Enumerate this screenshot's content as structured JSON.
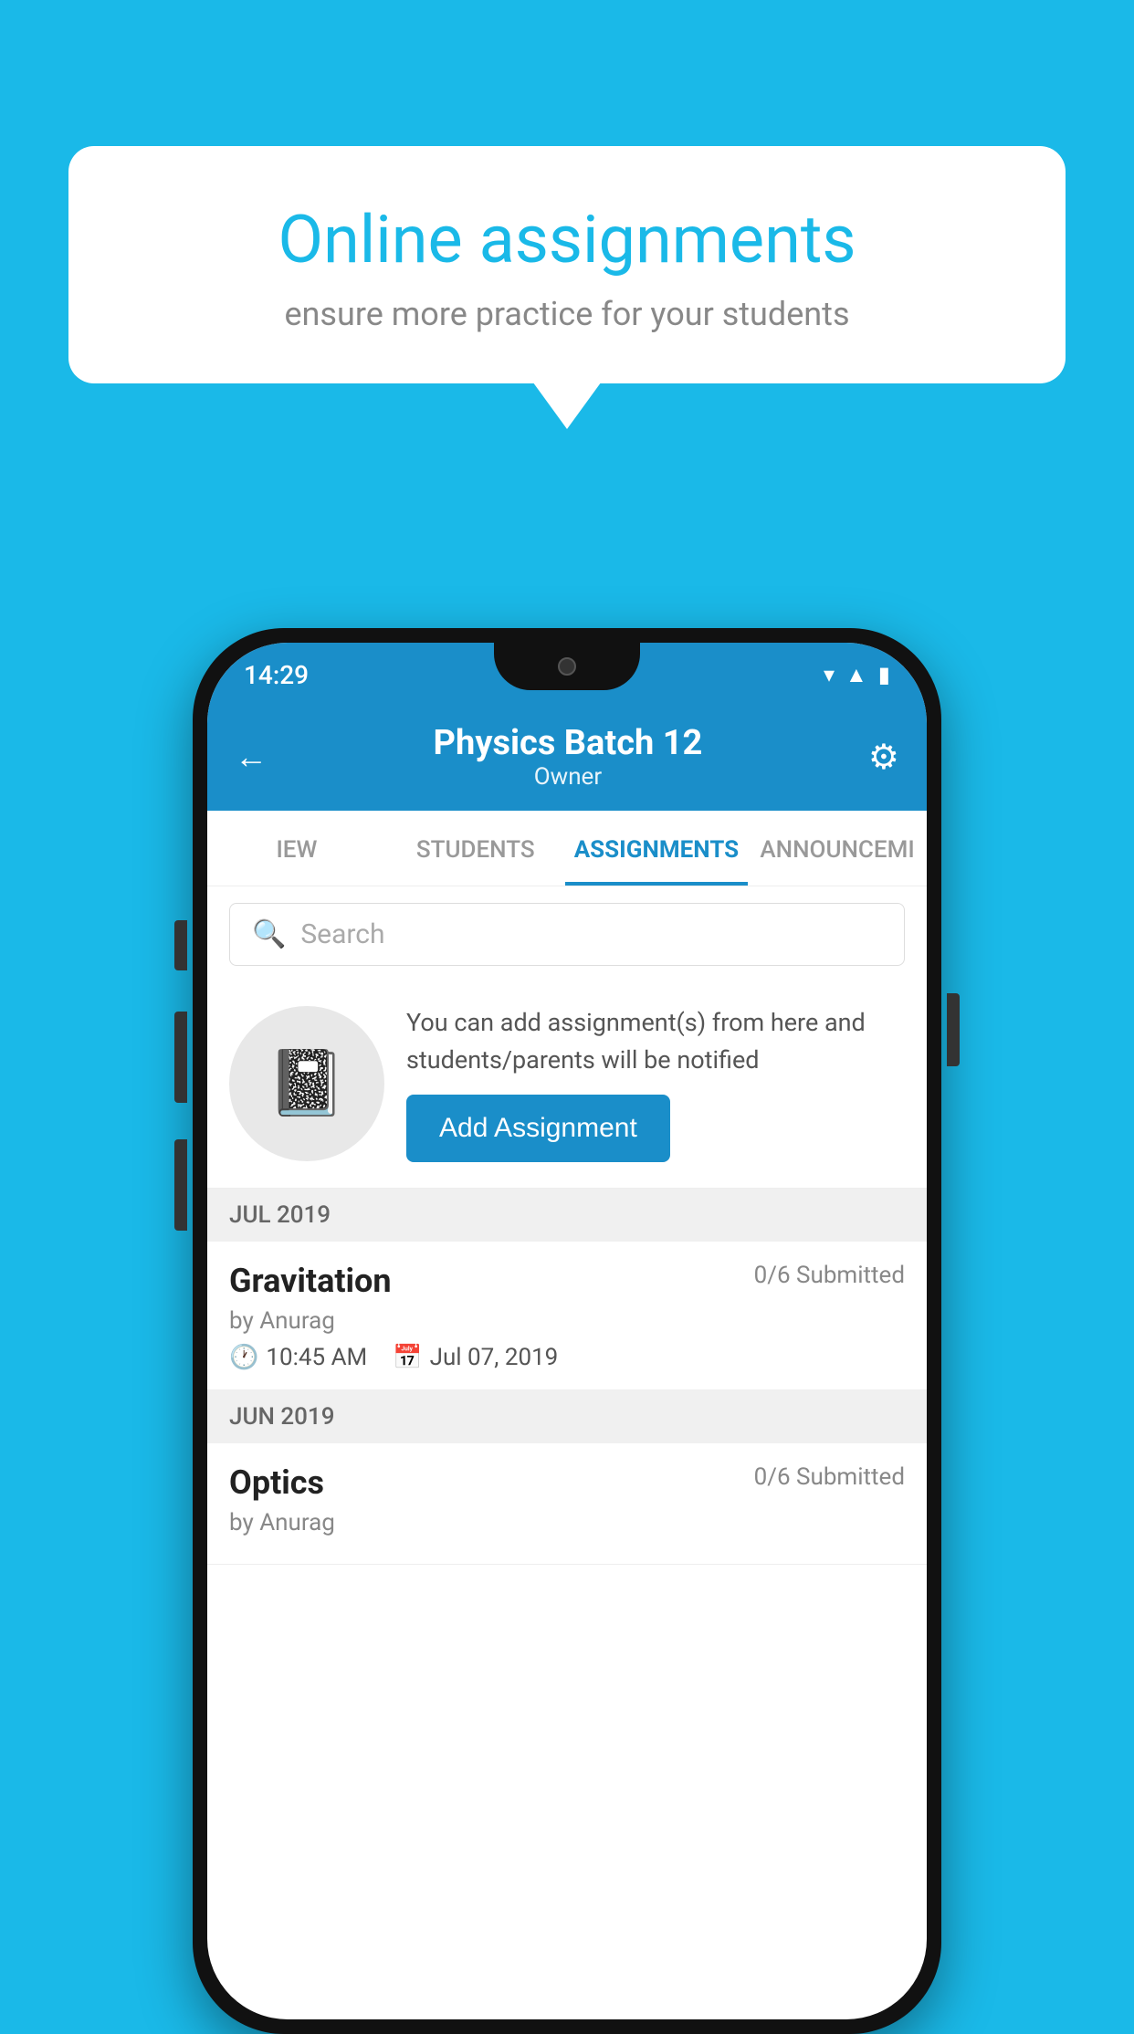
{
  "background_color": "#1ab9e8",
  "speech_bubble": {
    "title": "Online assignments",
    "subtitle": "ensure more practice for your students"
  },
  "phone": {
    "status_bar": {
      "time": "14:29",
      "icons": [
        "wifi",
        "signal",
        "battery"
      ]
    },
    "header": {
      "title": "Physics Batch 12",
      "subtitle": "Owner",
      "back_label": "←",
      "gear_label": "⚙"
    },
    "tabs": [
      {
        "label": "IEW",
        "active": false
      },
      {
        "label": "STUDENTS",
        "active": false
      },
      {
        "label": "ASSIGNMENTS",
        "active": true
      },
      {
        "label": "ANNOUNCEMI",
        "active": false
      }
    ],
    "search": {
      "placeholder": "Search"
    },
    "promo": {
      "icon": "📓",
      "description": "You can add assignment(s) from here and students/parents will be notified",
      "button_label": "Add Assignment"
    },
    "assignments": [
      {
        "month_header": "JUL 2019",
        "name": "Gravitation",
        "submitted": "0/6 Submitted",
        "by": "by Anurag",
        "time": "10:45 AM",
        "date": "Jul 07, 2019"
      },
      {
        "month_header": "JUN 2019",
        "name": "Optics",
        "submitted": "0/6 Submitted",
        "by": "by Anurag",
        "time": "",
        "date": ""
      }
    ]
  }
}
